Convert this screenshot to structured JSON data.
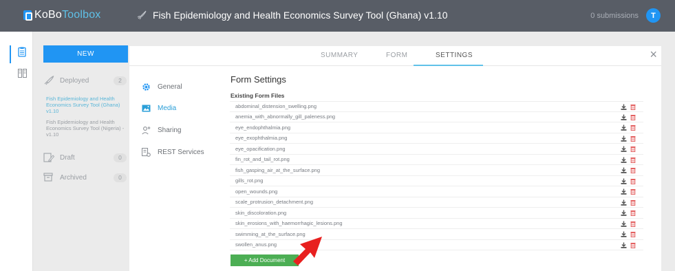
{
  "header": {
    "logo_part1": "KoBo",
    "logo_part2": "Toolbox",
    "form_title": "Fish Epidemiology and Health Economics Survey Tool (Ghana) v1.10",
    "submissions": "0 submissions",
    "avatar_initial": "T"
  },
  "sidebar": {
    "new_label": "NEW",
    "deployed_label": "Deployed",
    "deployed_count": "2",
    "deployed_forms": [
      "Fish Epidemiology and Health Economics Survey Tool (Ghana) v1.10",
      "Fish Epidemiology and Health Economics Survey Tool (Nigeria) - v1.10"
    ],
    "draft_label": "Draft",
    "draft_count": "0",
    "archived_label": "Archived",
    "archived_count": "0"
  },
  "tabs": {
    "summary": "SUMMARY",
    "form": "FORM",
    "settings": "SETTINGS",
    "active": "SETTINGS",
    "close": "×"
  },
  "settings_nav": {
    "general": "General",
    "media": "Media",
    "sharing": "Sharing",
    "rest_services": "REST Services",
    "active": "Media"
  },
  "content": {
    "title": "Form Settings",
    "existing_heading": "Existing Form Files",
    "files": [
      "abdominal_distension_swelling.png",
      "anemia_with_abnormally_gill_paleness.png",
      "eye_endophthalmia.png",
      "eye_exophthalmia.png",
      "eye_opacification.png",
      "fin_rot_and_tail_rot.png",
      "fish_gasping_air_at_the_surface.png",
      "gills_rot.png",
      "open_wounds.png",
      "scale_protrusion_detachment.png",
      "skin_discoloration.png",
      "skin_erosions_with_haemorrhagic_lesions.png",
      "swimming_at_the_surface.png",
      "swollen_anus.png"
    ],
    "add_document_label": "+ Add Document"
  },
  "colors": {
    "topbar": "#585d66",
    "accent_blue": "#2095f3",
    "add_green": "#4cae54",
    "delete_red": "#e25a5a",
    "arrow_red": "#e8201f"
  },
  "icons": {
    "rail": [
      "forms-icon",
      "library-icon"
    ],
    "row_actions": [
      "download-icon",
      "delete-icon"
    ]
  }
}
